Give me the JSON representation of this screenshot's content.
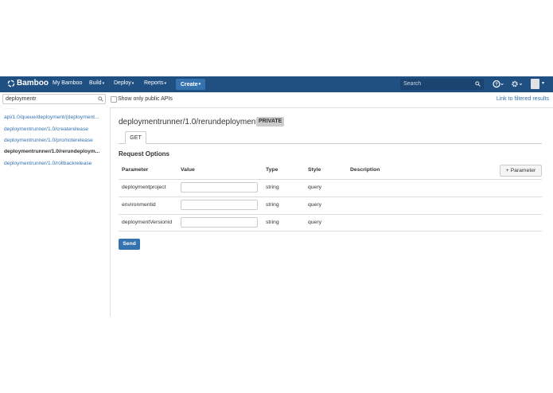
{
  "header": {
    "logo": "Bamboo",
    "nav": [
      "My Bamboo",
      "Build",
      "Deploy",
      "Reports"
    ],
    "create_label": "Create",
    "search_placeholder": "Search",
    "colors": {
      "bar": "#205081",
      "create": "#3572b0",
      "link": "#3572b0"
    }
  },
  "filter": {
    "query": "deploymentr",
    "show_public_label": "Show only public APIs",
    "show_public_checked": false,
    "link_label": "Link to filtered results"
  },
  "sidebar": {
    "items": [
      {
        "label": "api/1.0/queue/deployment/{deployment...",
        "active": false
      },
      {
        "label": "deploymentrunner/1.0/createrelease",
        "active": false
      },
      {
        "label": "deploymentrunner/1.0/promoterelease",
        "active": false
      },
      {
        "label": "deploymentrunner/1.0/rerundeploym...",
        "active": true
      },
      {
        "label": "deploymentrunner/1.0/rollbackrelease",
        "active": false
      }
    ]
  },
  "main": {
    "title": "deploymentrunner/1.0/rerundeployment",
    "badge": "PRIVATE",
    "tab": "GET",
    "section_title": "Request Options",
    "columns": [
      "Parameter",
      "Value",
      "Type",
      "Style",
      "Description"
    ],
    "add_param_label": "Parameter",
    "rows": [
      {
        "name": "deploymentproject",
        "value": "",
        "type": "string",
        "style": "query"
      },
      {
        "name": "environmentid",
        "value": "",
        "type": "string",
        "style": "query"
      },
      {
        "name": "deploymentVersionid",
        "value": "",
        "type": "string",
        "style": "query"
      }
    ],
    "send_label": "Send"
  }
}
